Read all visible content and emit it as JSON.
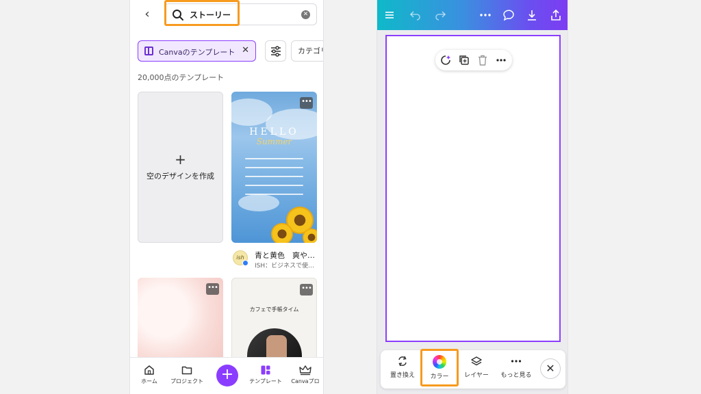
{
  "left_screen": {
    "search": {
      "query": "ストーリー"
    },
    "filters": {
      "chip_label": "Canvaのテンプレート",
      "category_label": "カテゴリ"
    },
    "result_count": "20,000点のテンプレート",
    "blank_card": {
      "plus": "+",
      "label": "空のデザインを作成"
    },
    "template1": {
      "hello": "HELLO",
      "summer": "Summer",
      "title": "青と黄色　爽や…",
      "author": "ISH：ビジネスで使…",
      "avatar_text": "ish"
    },
    "template3": {
      "caption": "カフェで手帳タイム"
    },
    "bottom_nav": {
      "home": "ホーム",
      "projects": "プロジェクト",
      "plus": "+",
      "templates": "テンプレート",
      "pro": "Canvaプロ"
    }
  },
  "right_screen": {
    "bottom_toolbar": {
      "replace": "置き換え",
      "color": "カラー",
      "layer": "レイヤー",
      "more": "もっと見る",
      "close": "✕"
    }
  },
  "colors": {
    "accent": "#8b3dff",
    "highlight": "#f79a1e",
    "topbar_gradient_start": "#0fb9c9",
    "topbar_gradient_end": "#7d3cf2"
  },
  "icons": [
    "back-arrow-icon",
    "search-icon",
    "clear-icon",
    "template-icon",
    "close-icon",
    "filter-icon",
    "more-icon",
    "home-icon",
    "folder-icon",
    "add-icon",
    "templates-icon",
    "crown-icon",
    "menu-icon",
    "undo-icon",
    "redo-icon",
    "comment-icon",
    "download-icon",
    "share-icon",
    "magic-icon",
    "duplicate-icon",
    "trash-icon",
    "replace-icon",
    "color-wheel-icon",
    "layers-icon"
  ]
}
